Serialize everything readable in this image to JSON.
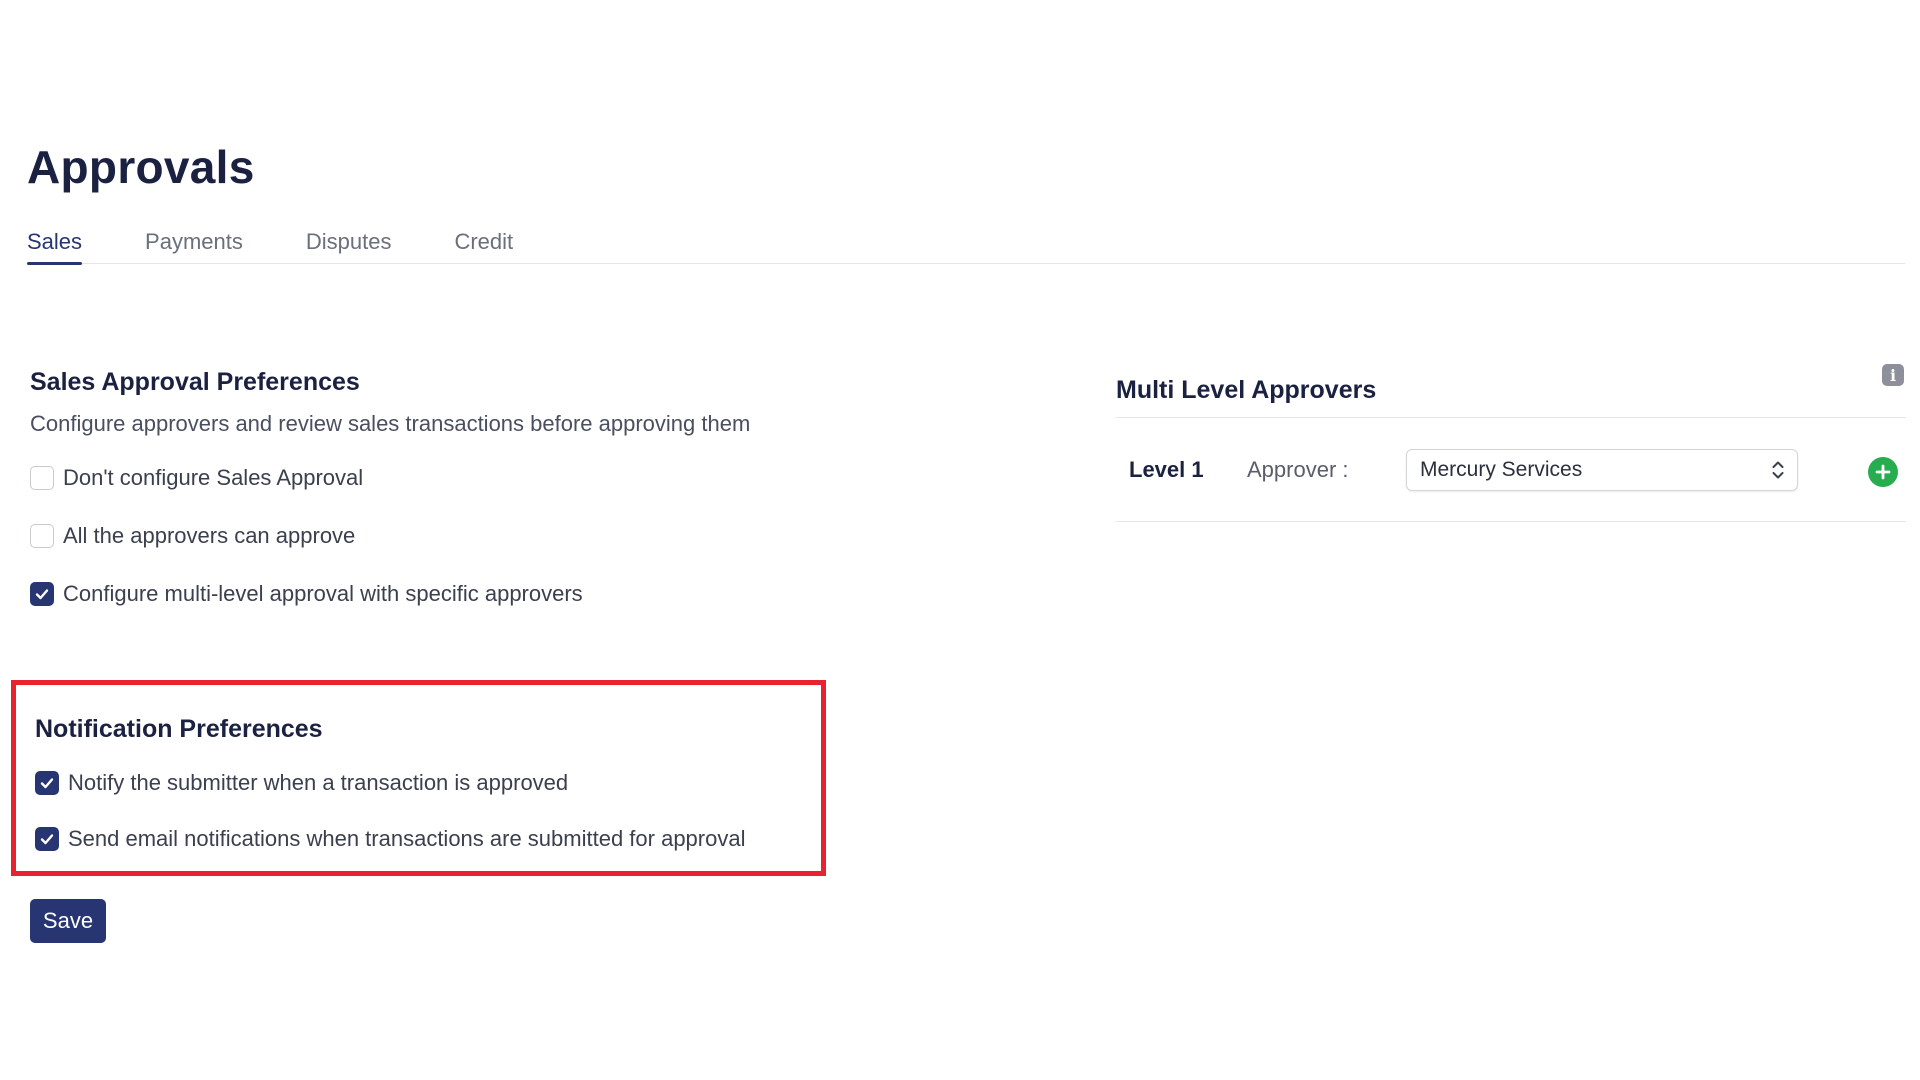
{
  "page": {
    "title": "Approvals"
  },
  "tabs": [
    {
      "label": "Sales",
      "active": true
    },
    {
      "label": "Payments",
      "active": false
    },
    {
      "label": "Disputes",
      "active": false
    },
    {
      "label": "Credit",
      "active": false
    }
  ],
  "sales_prefs": {
    "heading": "Sales Approval Preferences",
    "description": "Configure approvers and review sales transactions before approving them",
    "options": [
      {
        "label": "Don't configure Sales Approval",
        "checked": false
      },
      {
        "label": "All the approvers can approve",
        "checked": false
      },
      {
        "label": "Configure multi-level approval with specific approvers",
        "checked": true
      }
    ]
  },
  "notification_prefs": {
    "heading": "Notification Preferences",
    "options": [
      {
        "label": "Notify the submitter when a transaction is approved",
        "checked": true
      },
      {
        "label": "Send email notifications when transactions are submitted for approval",
        "checked": true
      }
    ],
    "highlight_color": "#e8232f"
  },
  "save_label": "Save",
  "multi_level": {
    "heading": "Multi Level Approvers",
    "info_icon": "info-icon",
    "levels": [
      {
        "level_label": "Level 1",
        "approver_label": "Approver :",
        "selected": "Mercury Services"
      }
    ],
    "add_icon": "plus-circle-icon"
  },
  "colors": {
    "primary": "#273673",
    "add_green": "#27ad4f",
    "highlight": "#e8232f"
  }
}
